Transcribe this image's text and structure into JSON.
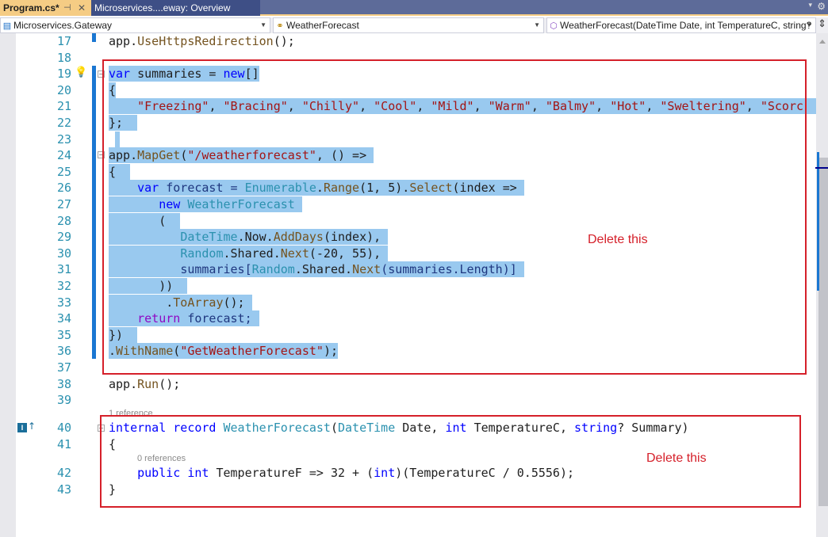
{
  "tabs": [
    {
      "label": "Program.cs*",
      "active": true,
      "pin_icon": "pin-icon",
      "close_icon": "close-icon"
    },
    {
      "label": "Microservices....eway: Overview",
      "active": false
    }
  ],
  "tabstrip": {
    "menu_icon": "▾",
    "gear_icon": "⚙"
  },
  "navbar": {
    "project": "Microservices.Gateway",
    "type": "WeatherForecast",
    "member": "WeatherForecast(DateTime Date, int TemperatureC, string?"
  },
  "editor": {
    "lines": [
      {
        "n": "17"
      },
      {
        "n": "18"
      },
      {
        "n": "19"
      },
      {
        "n": "20"
      },
      {
        "n": "21"
      },
      {
        "n": "22"
      },
      {
        "n": "23"
      },
      {
        "n": "24"
      },
      {
        "n": "25"
      },
      {
        "n": "26"
      },
      {
        "n": "27"
      },
      {
        "n": "28"
      },
      {
        "n": "29"
      },
      {
        "n": "30"
      },
      {
        "n": "31"
      },
      {
        "n": "32"
      },
      {
        "n": "33"
      },
      {
        "n": "34"
      },
      {
        "n": "35"
      },
      {
        "n": "36"
      },
      {
        "n": "37"
      },
      {
        "n": "38"
      },
      {
        "n": "39"
      },
      {
        "n": "40"
      },
      {
        "n": "41"
      },
      {
        "n": "42"
      },
      {
        "n": "43"
      }
    ],
    "code": {
      "l17": {
        "a": "app.",
        "b": "UseHttpsRedirection",
        "c": "();"
      },
      "l19": {
        "a": "var",
        "b": " summaries = ",
        "c": "new",
        "d": "[]"
      },
      "l20": "{",
      "l21": {
        "items": [
          "\"Freezing\"",
          "\"Bracing\"",
          "\"Chilly\"",
          "\"Cool\"",
          "\"Mild\"",
          "\"Warm\"",
          "\"Balmy\"",
          "\"Hot\"",
          "\"Sweltering\"",
          "\"Scorc"
        ]
      },
      "l22": "};",
      "l24": {
        "a": "app.",
        "b": "MapGet",
        "c": "(",
        "d": "\"/weatherforecast\"",
        "e": ", () =>"
      },
      "l25": "{",
      "l26": {
        "a": "var",
        "b": " forecast = ",
        "c": "Enumerable",
        "d": ".",
        "e": "Range",
        "f": "(1, 5).",
        "g": "Select",
        "h": "(index =>"
      },
      "l27": {
        "a": "new",
        "b": "WeatherForecast"
      },
      "l28": "(",
      "l29": {
        "a": "DateTime",
        "b": ".Now.",
        "c": "AddDays",
        "d": "(index),"
      },
      "l30": {
        "a": "Random",
        "b": ".Shared.",
        "c": "Next",
        "d": "(-20, 55),"
      },
      "l31": {
        "a": "summaries[",
        "b": "Random",
        "c": ".Shared.",
        "d": "Next",
        "e": "(summaries.Length)]"
      },
      "l32": "))",
      "l33": {
        "a": ".",
        "b": "ToArray",
        "c": "();"
      },
      "l34": {
        "a": "return",
        "b": " forecast;"
      },
      "l35": "})",
      "l36": {
        "a": ".",
        "b": "WithName",
        "c": "(",
        "d": "\"GetWeatherForecast\"",
        "e": ");"
      },
      "l38": {
        "a": "app.",
        "b": "Run",
        "c": "();"
      },
      "l40": {
        "a": "internal",
        "b": " ",
        "c": "record",
        "d": " ",
        "e": "WeatherForecast",
        "f": "(",
        "g": "DateTime",
        "h": " Date, ",
        "i": "int",
        "j": " TemperatureC, ",
        "k": "string",
        "l": "? Summary)"
      },
      "l41": "{",
      "l42": {
        "a": "public",
        "b": " ",
        "c": "int",
        "d": " TemperatureF => 32 + (",
        "e": "int",
        "f": ")(TemperatureC / 0.5556);"
      },
      "l43": "}"
    },
    "codelens": {
      "record_refs": "1 reference",
      "property_refs": "0 references"
    }
  },
  "annotations": [
    {
      "label": "Delete this",
      "color": "#d5202a"
    },
    {
      "label": "Delete this",
      "color": "#d5202a"
    }
  ]
}
